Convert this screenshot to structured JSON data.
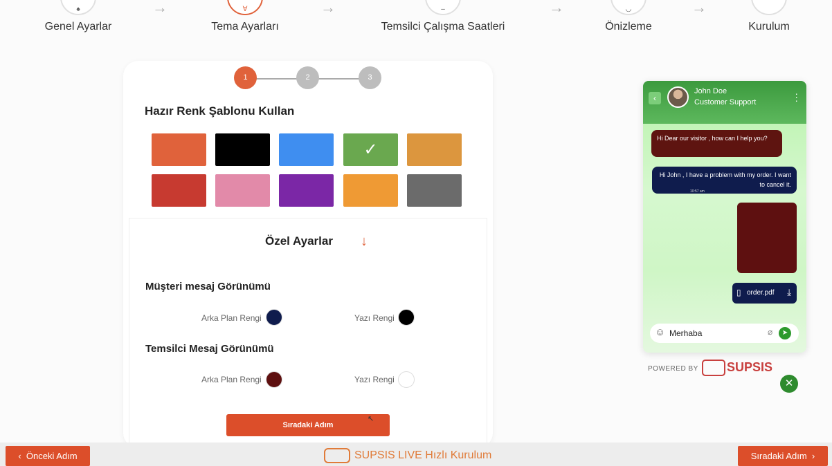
{
  "wizard": {
    "steps": [
      {
        "label": "Genel Ayarlar"
      },
      {
        "label": "Tema Ayarları"
      },
      {
        "label": "Temsilci Çalışma Saatleri"
      },
      {
        "label": "Önizleme"
      },
      {
        "label": "Kurulum"
      }
    ],
    "active_step": 1,
    "arrow": "→"
  },
  "sub_steps": [
    "1",
    "2",
    "3"
  ],
  "template_section": {
    "title": "Hazır Renk Şablonu Kullan",
    "swatches": [
      {
        "color": "#e0623b"
      },
      {
        "color": "#000000"
      },
      {
        "color": "#3f8ef0"
      },
      {
        "color": "#6aa84f",
        "selected": true
      },
      {
        "color": "#dc963e"
      },
      {
        "color": "#c73a30"
      },
      {
        "color": "#e28aa9"
      },
      {
        "color": "#7b27a6"
      },
      {
        "color": "#ef9a34"
      },
      {
        "color": "#6b6b6b"
      }
    ],
    "check_mark": "✓"
  },
  "custom_section": {
    "title": "Özel Ayarlar",
    "toggle_icon": "↓",
    "customer": {
      "title": "Müşteri mesaj Görünümü",
      "bg_label": "Arka Plan Rengi",
      "bg_color": "#0f1c4d",
      "text_label": "Yazı Rengi",
      "text_color": "#000000"
    },
    "agent": {
      "title": "Temsilci Mesaj Görünümü",
      "bg_label": "Arka Plan Rengi",
      "bg_color": "#5e1010",
      "text_label": "Yazı Rengi",
      "text_color": "#ffffff"
    },
    "next_button": "Sıradaki Adım"
  },
  "chat_preview": {
    "agent_name": "John Doe",
    "agent_role": "Customer Support",
    "messages": {
      "agent": "Hi Dear our visitor , how can I help you?",
      "user": "Hi John , I have a problem with my order. I want to cancel it.",
      "time": "10:57 am"
    },
    "file_name": "order.pdf",
    "input_value": "Merhaba",
    "powered_by": "POWERED BY",
    "powered_logo": "SUPSIS"
  },
  "bottom_bar": {
    "prev_label": "Önceki Adım",
    "next_label": "Sıradaki Adım",
    "brand": "SUPSIS LIVE Hızlı Kurulum"
  }
}
